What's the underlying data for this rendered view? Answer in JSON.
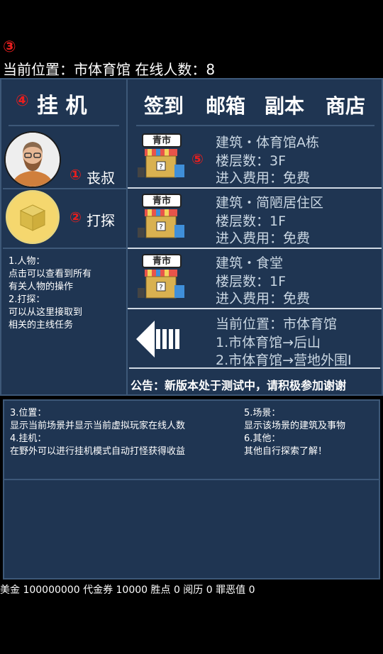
{
  "top": {
    "marker3": "③",
    "location_line": "当前位置：市体育馆 在线人数：8"
  },
  "left": {
    "marker4": "④",
    "idle_title": "挂 机",
    "marker1": "①",
    "person_label": "丧叔",
    "marker2": "②",
    "explore_label": "打探",
    "help": [
      "1.人物：",
      "点击可以查看到所有",
      "有关人物的操作",
      "2.打探：",
      "可以从这里接取到",
      "相关的主线任务"
    ]
  },
  "tabs": [
    "签到",
    "邮箱",
    "副本",
    "商店"
  ],
  "buildings": [
    {
      "tag": "青市",
      "name": "建筑・体育馆A栋",
      "floors": "楼层数：3F",
      "fee": "进入费用：免费"
    },
    {
      "tag": "青市",
      "name": "建筑・简陋居住区",
      "floors": "楼层数：1F",
      "fee": "进入费用：免费"
    },
    {
      "tag": "青市",
      "name": "建筑・食堂",
      "floors": "楼层数：1F",
      "fee": "进入费用：免费"
    }
  ],
  "marker5": "⑤",
  "nav": {
    "current": "当前位置：市体育馆",
    "route1": "1.市体育馆→后山",
    "route2": "2.市体育馆→营地外围I"
  },
  "notice": "公告：新版本处于测试中，请积极参加谢谢",
  "info": {
    "col1": [
      "3.位置：",
      "显示当前场景并显示当前虚拟玩家在线人数",
      "4.挂机：",
      "在野外可以进行挂机模式自动打怪获得收益"
    ],
    "col2": [
      "5.场景：",
      "显示该场景的建筑及事物",
      "6.其他：",
      "其他自行探索了解！"
    ]
  },
  "status_bar": "美金 100000000 代金券 10000 胜点 0 阅历 0 罪恶值 0",
  "colors": {
    "accent_red": "#e81e1e",
    "panel_bg": "#1f3552",
    "panel_border": "#3d5878",
    "coin": "#f5d76e"
  }
}
